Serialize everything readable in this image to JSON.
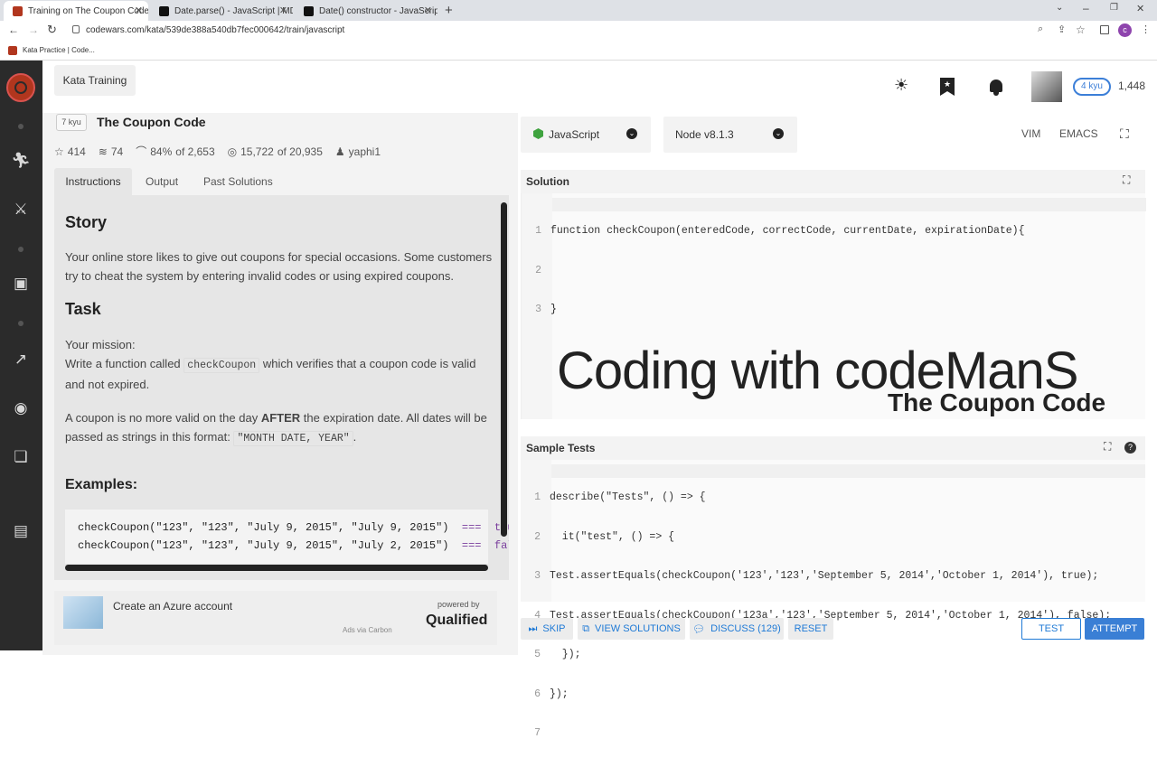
{
  "browser": {
    "tabs": [
      {
        "title": "Training on The Coupon Code | C",
        "active": true
      },
      {
        "title": "Date.parse() - JavaScript | MDN",
        "active": false
      },
      {
        "title": "Date() constructor - JavaScript | M",
        "active": false
      }
    ],
    "url": "codewars.com/kata/539de388a540db7fec000642/train/javascript",
    "bookmark": "Kata Practice | Code..."
  },
  "header": {
    "breadcrumb": "Kata Training",
    "rank": "4 kyu",
    "honor": "1,448"
  },
  "kata": {
    "kyu": "7 kyu",
    "title": "The Coupon Code",
    "stars": "414",
    "collections": "74",
    "satisfaction": "84%",
    "satisfaction_of": "of 2,653",
    "completed": "15,722",
    "completed_of": "of 20,935",
    "author": "yaphi1"
  },
  "left_tabs": [
    "Instructions",
    "Output",
    "Past Solutions"
  ],
  "instructions": {
    "story_heading": "Story",
    "story_text": "Your online store likes to give out coupons for special occasions. Some customers try to cheat the system by entering invalid codes or using expired coupons.",
    "task_heading": "Task",
    "mission_label": "Your mission:",
    "mission_pre": "Write a function called",
    "mission_code": "checkCoupon",
    "mission_post": "which verifies that a coupon code is valid and not expired.",
    "rule_pre": "A coupon is no more valid on the day",
    "rule_bold": "AFTER",
    "rule_mid": "the expiration date. All dates will be passed as strings in this format:",
    "rule_code": "\"MONTH DATE, YEAR\"",
    "rule_end": ".",
    "examples_heading": "Examples:",
    "examples": [
      {
        "call": "checkCoupon(\"123\", \"123\", \"July 9, 2015\", \"July 9, 2015\")",
        "op": "===",
        "result": "true"
      },
      {
        "call": "checkCoupon(\"123\", \"123\", \"July 9, 2015\", \"July 2, 2015\")",
        "op": "===",
        "result": "false"
      }
    ]
  },
  "ad": {
    "text": "Create an Azure account",
    "powered": "powered by",
    "brand": "Qualified",
    "via": "Ads via Carbon"
  },
  "editor": {
    "language": "JavaScript",
    "runtime": "Node v8.1.3",
    "vim": "VIM",
    "emacs": "EMACS",
    "solution_label": "Solution",
    "solution_lines": [
      "function checkCoupon(enteredCode, correctCode, currentDate, expirationDate){",
      "",
      "}"
    ],
    "overlay_title": "Coding with codeManS",
    "overlay_subtitle": "The Coupon Code",
    "tests_label": "Sample Tests",
    "test_lines": [
      "describe(\"Tests\", () => {",
      "  it(\"test\", () => {",
      "Test.assertEquals(checkCoupon('123','123','September 5, 2014','October 1, 2014'), true);",
      "Test.assertEquals(checkCoupon('123a','123','September 5, 2014','October 1, 2014'), false);",
      "  });",
      "});",
      ""
    ]
  },
  "actions": {
    "skip": "SKIP",
    "view_solutions": "VIEW SOLUTIONS",
    "discuss": "DISCUSS (129)",
    "reset": "RESET",
    "test": "TEST",
    "attempt": "ATTEMPT"
  },
  "colors": {
    "sidebar": "#2b2b2b",
    "accent_blue": "#1f7ad6",
    "attempt_bg": "#3a7fd5",
    "brand_red": "#b1361e"
  }
}
